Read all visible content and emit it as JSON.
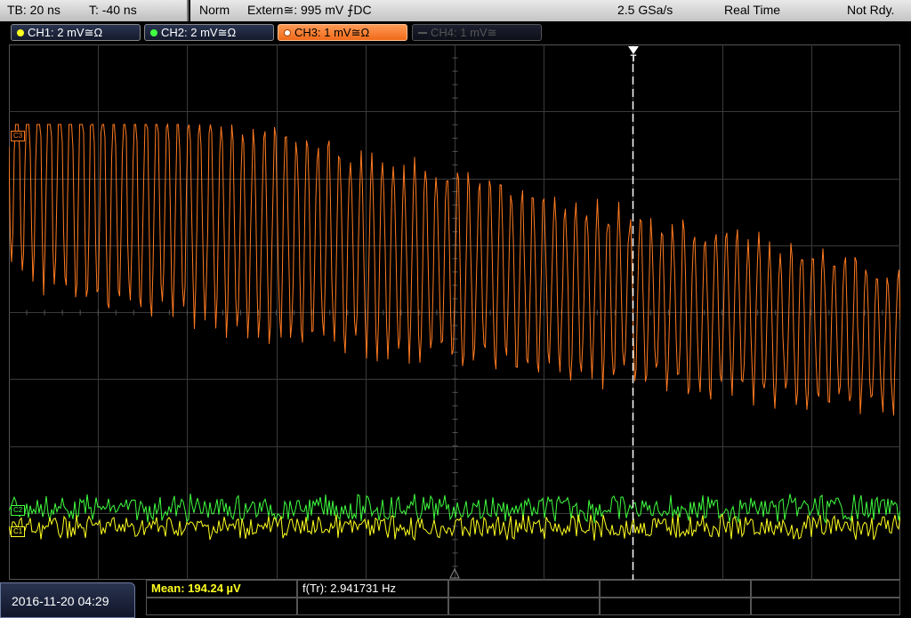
{
  "status_bar": {
    "timebase": "TB: 20 ns",
    "trigger_time": "T: -40 ns",
    "trigger_mode": "Norm",
    "trigger_source": "Extern≅: 995 mV ⨍DC",
    "sample_rate": "2.5 GSa/s",
    "acq_mode": "Real Time",
    "status": "Not Rdy."
  },
  "channels": [
    {
      "label": "CH1: 2 mV≅Ω",
      "color": "#ffff20",
      "state": "on"
    },
    {
      "label": "CH2: 2 mV≅Ω",
      "color": "#40ff40",
      "state": "on"
    },
    {
      "label": "CH3: 1 mV≅Ω",
      "color": "#ff7a20",
      "state": "active"
    },
    {
      "label": "CH4: 1 mV≅",
      "color": "#555555",
      "state": "off"
    }
  ],
  "markers": {
    "ch3": "C3",
    "ch2": "C2",
    "ch1": "C1",
    "trigger": "T"
  },
  "colors": {
    "ch1": "#ffff20",
    "ch2": "#40ff40",
    "ch3": "#ff7a20",
    "grid": "#3a3a3a",
    "background": "#000000"
  },
  "datetime": "2016-11-20 04:29",
  "measurements": {
    "mean": "Mean: 194.24 µV",
    "freq": "f(Tr): 2.941731 Hz"
  },
  "chart_data": {
    "type": "line",
    "title": "",
    "xlabel": "",
    "ylabel": "",
    "grid_divisions": {
      "x": 10,
      "y": 8
    },
    "series": [
      {
        "name": "CH3",
        "description_values": "decaying oscillation"
      },
      {
        "name": "CH2",
        "description_values": "noise"
      },
      {
        "name": "CH1",
        "description_values": "noise"
      }
    ]
  }
}
